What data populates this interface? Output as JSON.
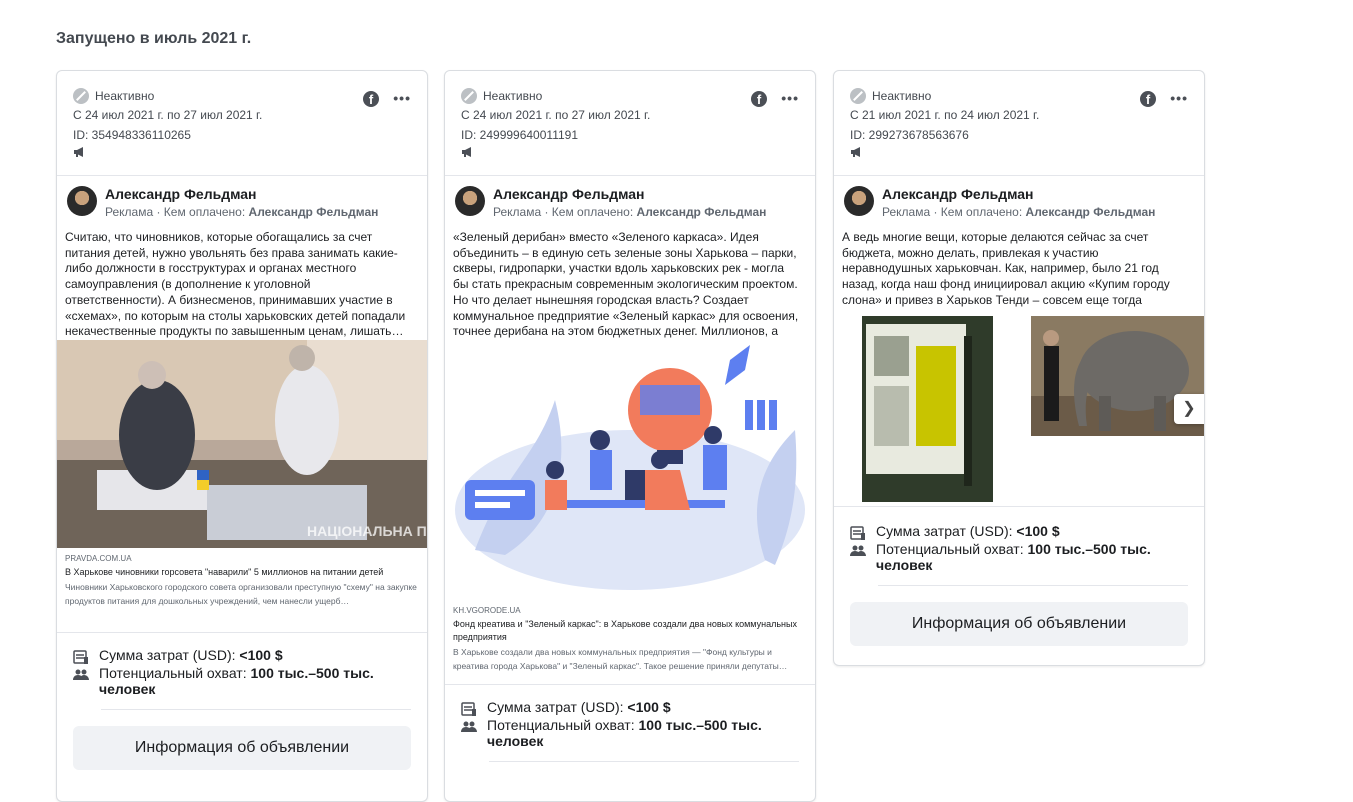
{
  "section": {
    "title": "Запущено в июль 2021 г."
  },
  "cards": [
    {
      "status": "Неактивно",
      "dates": "С 24 июл 2021 г. по 27 июл 2021 г.",
      "ad_id": "ID: 354948336110265",
      "author": "Александр Фельдман",
      "sponsored": "Реклама · Кем оплачено:",
      "payer": "Александр Фельдман",
      "text": "Считаю, что чиновников, которые обогащались за счет питания детей, нужно увольнять без права занимать какие-либо должности в госструктурах и органах местного самоуправления (в дополнение к уголовной ответственности). А бизнесменов, принимавших участие в «схемах», по которым на столы харьковских детей попадали некачественные продукты по завышенным ценам, лишать…",
      "image_label": "НАЦІОНАЛЬНА ПОЛІЦІЯ",
      "link_domain": "PRAVDA.COM.UA",
      "link_title": "В Харькове чиновники горсовета \"наварили\" 5 миллионов на питании детей",
      "link_desc": "Чиновники Харьковского городского совета организовали преступную \"схему\" на закупке продуктов питания для дошкольных учреждений, чем нанесли ущерб…",
      "spend_label": "Сумма затрат (USD):",
      "spend_value": "<100 $",
      "reach_label": "Потенциальный охват:",
      "reach_value": "100 тыс.–500 тыс. человек",
      "button": "Информация об объявлении"
    },
    {
      "status": "Неактивно",
      "dates": "С 24 июл 2021 г. по 27 июл 2021 г.",
      "ad_id": "ID: 249999640011191",
      "author": "Александр Фельдман",
      "sponsored": "Реклама · Кем оплачено:",
      "payer": "Александр Фельдман",
      "text": "«Зеленый дерибан» вместо «Зеленого каркаса». Идея объединить – в единую сеть зеленые зоны Харькова – парки, скверы, гидропарки, участки вдоль харьковских рек - могла бы стать прекрасным современным экологическим проектом. Но что делает нынешняя городская власть? Создает коммунальное предприятие «Зеленый каркас» для освоения, точнее дерибана на этом бюджетных денег. Миллионов, а то…",
      "link_domain": "KH.VGORODE.UA",
      "link_title": "Фонд креатива и \"Зеленый каркас\": в Харькове создали два новых коммунальных предприятия",
      "link_desc": "В Харькове создали два новых коммунальных предприятия — \"Фонд культуры и креатива города Харькова\" и \"Зеленый каркас\". Такое решение приняли депутаты…",
      "spend_label": "Сумма затрат (USD):",
      "spend_value": "<100 $",
      "reach_label": "Потенциальный охват:",
      "reach_value": "100 тыс.–500 тыс. человек",
      "button": "Информация об объявлении"
    },
    {
      "status": "Неактивно",
      "dates": "С 21 июл 2021 г. по 24 июл 2021 г.",
      "ad_id": "ID: 299273678563676",
      "author": "Александр Фельдман",
      "sponsored": "Реклама · Кем оплачено:",
      "payer": "Александр Фельдман",
      "text": "А ведь многие вещи, которые делаются сейчас за счет бюджета, можно делать, привлекая к участию неравнодушных харьковчан. Как, например, было 21 год назад, когда наш фонд инициировал акцию «Купим городу слона» и привез в Харьков Тенди – совсем еще тогда малышку.",
      "spend_label": "Сумма затрат (USD):",
      "spend_value": "<100 $",
      "reach_label": "Потенциальный охват:",
      "reach_value": "100 тыс.–500 тыс. человек",
      "button": "Информация об объявлении"
    }
  ]
}
